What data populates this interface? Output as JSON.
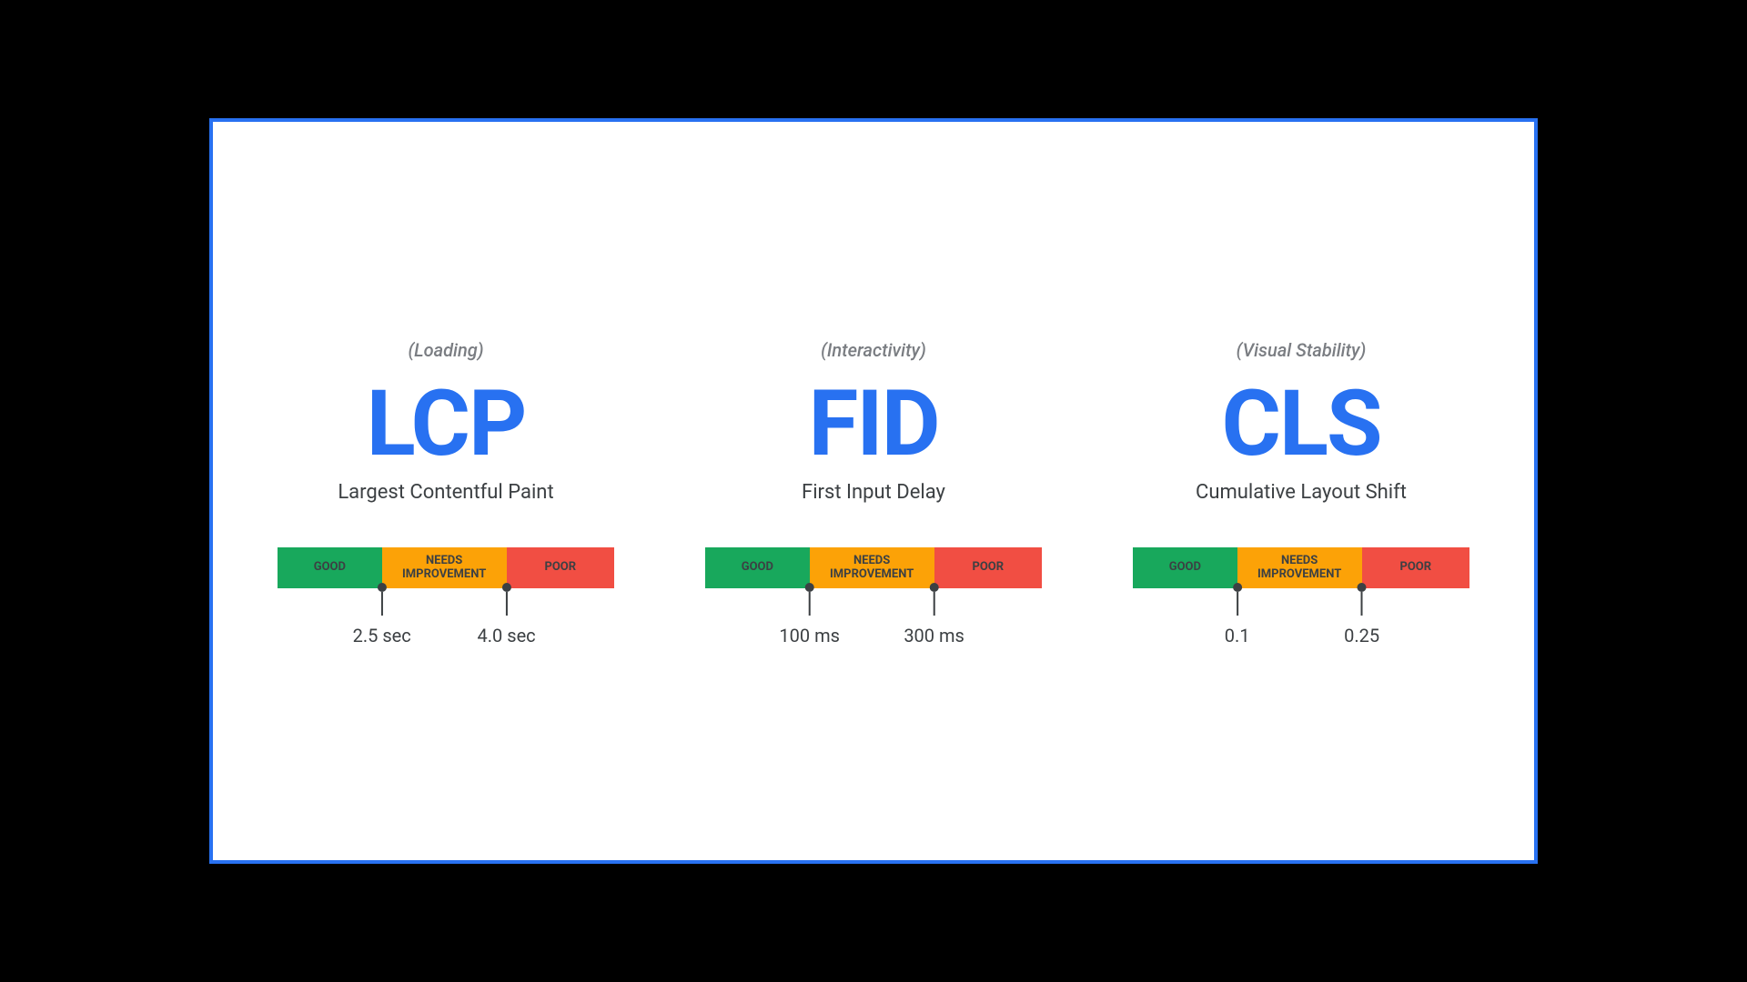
{
  "colors": {
    "good": "#18a85c",
    "needs": "#fca207",
    "poor": "#f14e43",
    "accent": "#2871f1"
  },
  "labels": {
    "good": "GOOD",
    "needs": "NEEDS\nIMPROVEMENT",
    "poor": "POOR"
  },
  "metrics": [
    {
      "category": "(Loading)",
      "abbrev": "LCP",
      "fullname": "Largest Contentful Paint",
      "threshold1": "2.5 sec",
      "threshold2": "4.0 sec"
    },
    {
      "category": "(Interactivity)",
      "abbrev": "FID",
      "fullname": "First Input Delay",
      "threshold1": "100 ms",
      "threshold2": "300 ms"
    },
    {
      "category": "(Visual Stability)",
      "abbrev": "CLS",
      "fullname": "Cumulative Layout Shift",
      "threshold1": "0.1",
      "threshold2": "0.25"
    }
  ]
}
